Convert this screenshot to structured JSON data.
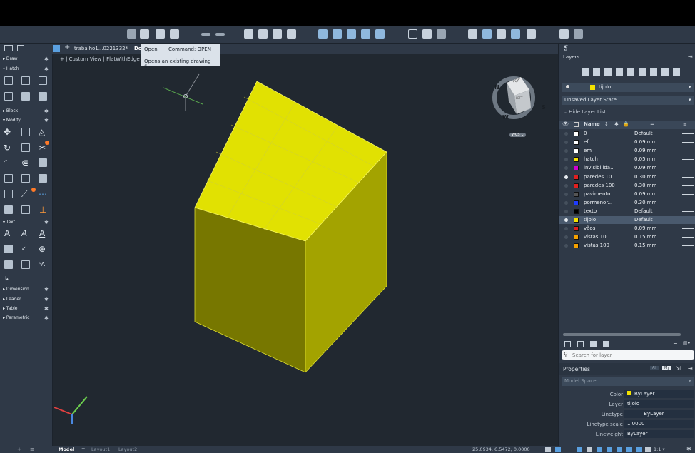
{
  "tabs": {
    "menu_glyph": "☰",
    "add": "+",
    "doc": "trabalho1...0221332*",
    "doc_cut": "Do",
    "view_header": "+ | Custom View | FlatWithEdge"
  },
  "popup": {
    "cmd_short": "Open",
    "cmd": "Command: OPEN",
    "desc": "Opens an existing drawing file"
  },
  "left": {
    "sections": [
      {
        "label": "▸ Draw"
      },
      {
        "label": "▾ Hatch"
      },
      {
        "label": "▸ Block"
      },
      {
        "label": "▾ Modify"
      },
      {
        "label": "▾ Text"
      },
      {
        "label": "▸ Dimension"
      },
      {
        "label": "▸ Leader"
      },
      {
        "label": "▸ Table"
      },
      {
        "label": "▸ Parametric"
      }
    ],
    "text_tools": {
      "a_big": "A",
      "a_style": "A",
      "a_under": "A"
    }
  },
  "viewcube": {
    "top": "TOP",
    "face": "LEFT",
    "n": "N",
    "w": "W",
    "s": "S",
    "wcs": "WCS ⌄"
  },
  "layers": {
    "title": "Layers",
    "current": "tijolo",
    "state": "Unsaved Layer State",
    "hide": "Hide Layer List",
    "col_name": "Name",
    "col_lw": "=",
    "rows": [
      {
        "name": "0",
        "lw": "Default",
        "color": "#ffffff",
        "on": false
      },
      {
        "name": "ef",
        "lw": "0.09 mm",
        "color": "#ffffff",
        "on": false
      },
      {
        "name": "em",
        "lw": "0.09 mm",
        "color": "#ffffff",
        "on": false
      },
      {
        "name": "hatch",
        "lw": "0.05 mm",
        "color": "#f4e200",
        "on": false
      },
      {
        "name": "invisibilida...",
        "lw": "0.09 mm",
        "color": "#d100d1",
        "on": false
      },
      {
        "name": "paredes 10",
        "lw": "0.30 mm",
        "color": "#e02020",
        "on": true
      },
      {
        "name": "paredes 100",
        "lw": "0.30 mm",
        "color": "#e02020",
        "on": false
      },
      {
        "name": "pavimento",
        "lw": "0.09 mm",
        "color": "#555555",
        "on": false
      },
      {
        "name": "pormenor...",
        "lw": "0.30 mm",
        "color": "#1e3cff",
        "on": false
      },
      {
        "name": "texto",
        "lw": "Default",
        "color": "#000000",
        "on": false
      },
      {
        "name": "tijolo",
        "lw": "Default",
        "color": "#f4e200",
        "on": true
      },
      {
        "name": "vãos",
        "lw": "0.09 mm",
        "color": "#e02020",
        "on": false
      },
      {
        "name": "vistas 10",
        "lw": "0.15 mm",
        "color": "#f4a000",
        "on": false
      },
      {
        "name": "vistas 100",
        "lw": "0.15 mm",
        "color": "#f4a000",
        "on": false
      }
    ],
    "search_placeholder": "Search for layer"
  },
  "properties": {
    "title": "Properties",
    "all": "All",
    "my": "My",
    "scope": "Model Space",
    "fields": [
      {
        "label": "Color",
        "value": "ByLayer"
      },
      {
        "label": "Layer",
        "value": "tijolo"
      },
      {
        "label": "Linetype",
        "value": "——— ByLayer"
      },
      {
        "label": "Linetype scale",
        "value": "1.0000"
      },
      {
        "label": "Lineweight",
        "value": "ByLayer"
      }
    ]
  },
  "bottom": {
    "model": "Model",
    "plus": "+",
    "layout1": "Layout1",
    "layout2": "Layout2",
    "coords": "25.0934, 6.5472, 0.0000",
    "scale": "1:1 ▾"
  }
}
